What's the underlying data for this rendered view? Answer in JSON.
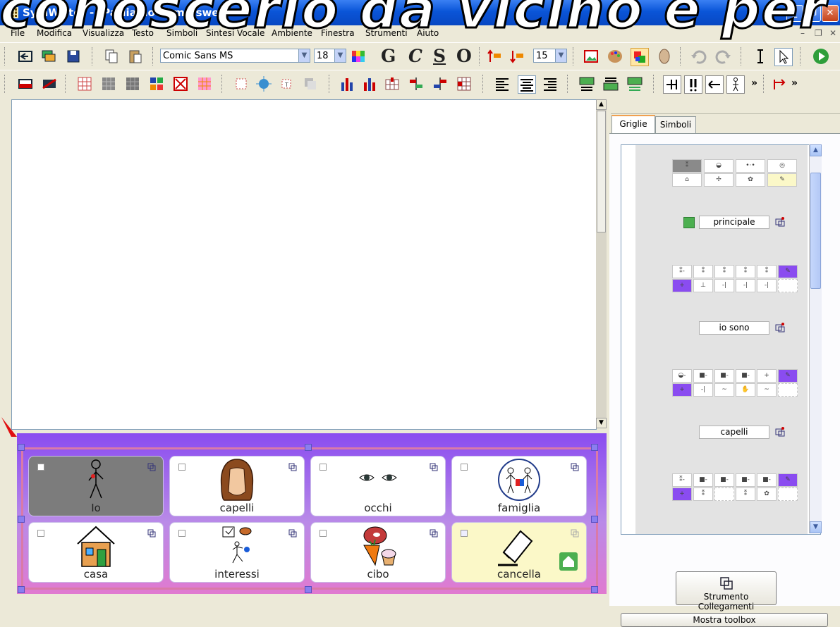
{
  "window": {
    "title": "SymWriter - [Parliamo di me.swe]",
    "overlay_text": "conoscerlo da vicino e per"
  },
  "menubar": {
    "items": [
      "File",
      "Modifica",
      "Visualizza",
      "Testo",
      "Simboli",
      "Sintesi Vocale",
      "Ambiente",
      "Finestra",
      "Strumenti",
      "Aiuto"
    ]
  },
  "toolbar": {
    "font": "Comic Sans MS",
    "font_size": "18",
    "spacing": "15",
    "bold": "G",
    "italic": "C",
    "underline": "S",
    "outline": "O",
    "more": "»"
  },
  "grid": {
    "cells": [
      {
        "label": "Io",
        "style": "dark",
        "picture": "person-icon"
      },
      {
        "label": "capelli",
        "style": "normal",
        "picture": "hair-icon"
      },
      {
        "label": "occhi",
        "style": "normal",
        "picture": "eyes-icon"
      },
      {
        "label": "famiglia",
        "style": "normal",
        "picture": "family-icon"
      },
      {
        "label": "casa",
        "style": "normal",
        "picture": "house-icon"
      },
      {
        "label": "interessi",
        "style": "normal",
        "picture": "interests-icon"
      },
      {
        "label": "cibo",
        "style": "normal",
        "picture": "food-icon"
      },
      {
        "label": "cancella",
        "style": "yellow",
        "picture": "eraser-icon"
      }
    ]
  },
  "right_panel": {
    "tabs": [
      "Griglie",
      "Simboli"
    ],
    "active_tab": "Griglie",
    "grid_names": [
      "principale",
      "io sono",
      "capelli"
    ],
    "collegamenti_button": "Strumento Collegamenti",
    "toolbox_button": "Mostra toolbox"
  }
}
